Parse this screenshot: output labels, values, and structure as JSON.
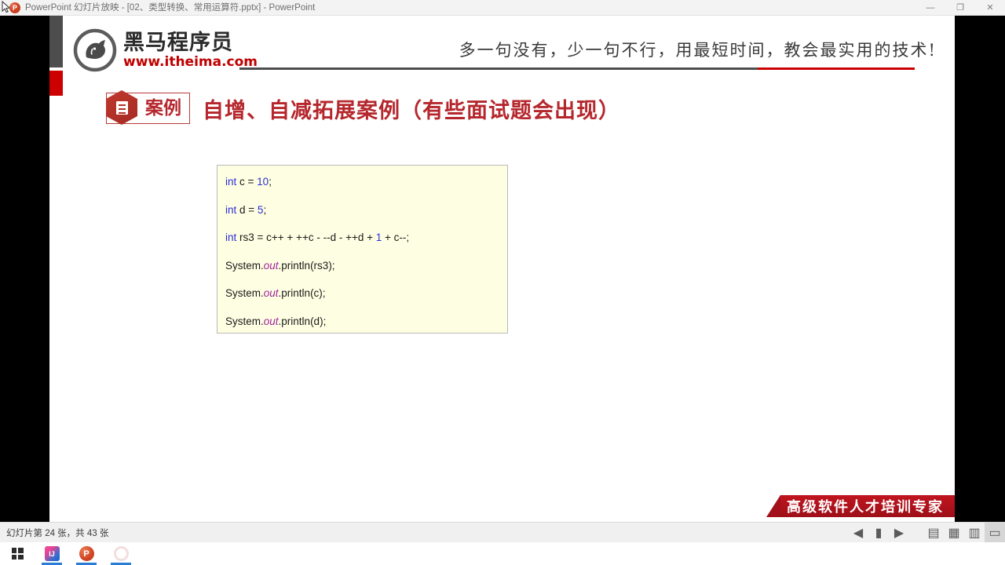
{
  "window": {
    "title": "PowerPoint 幻灯片放映 - [02、类型转换、常用运算符.pptx] - PowerPoint",
    "app_icon": "powerpoint-icon",
    "minimize_label": "—",
    "maximize_label": "❐",
    "close_label": "✕"
  },
  "slide": {
    "logo": {
      "brand_cn": "黑马程序员",
      "url": "www.itheima.com",
      "mark": "horse-logo-icon"
    },
    "tagline": "多一句没有，少一句不行，用最短时间，教会最实用的技术!",
    "badge": {
      "icon": "document-hex-icon",
      "label": "案例"
    },
    "title": "自增、自减拓展案例（有些面试题会出现）",
    "code": {
      "lines": [
        {
          "segments": [
            {
              "t": "int ",
              "c": "kw"
            },
            {
              "t": "c = ",
              "c": ""
            },
            {
              "t": "10",
              "c": "num"
            },
            {
              "t": ";",
              "c": ""
            }
          ]
        },
        {
          "segments": [
            {
              "t": "int ",
              "c": "kw"
            },
            {
              "t": "d = ",
              "c": ""
            },
            {
              "t": "5",
              "c": "num"
            },
            {
              "t": ";",
              "c": ""
            }
          ]
        },
        {
          "segments": [
            {
              "t": "int ",
              "c": "kw"
            },
            {
              "t": "rs3 = c++ + ++c - --d - ++d + ",
              "c": ""
            },
            {
              "t": "1",
              "c": "num"
            },
            {
              "t": " + c--;",
              "c": ""
            }
          ]
        },
        {
          "segments": [
            {
              "t": "System.",
              "c": ""
            },
            {
              "t": "out",
              "c": "fld"
            },
            {
              "t": ".println(rs3);",
              "c": ""
            }
          ]
        },
        {
          "segments": [
            {
              "t": "System.",
              "c": ""
            },
            {
              "t": "out",
              "c": "fld"
            },
            {
              "t": ".println(c);",
              "c": ""
            }
          ]
        },
        {
          "segments": [
            {
              "t": "System.",
              "c": ""
            },
            {
              "t": "out",
              "c": "fld"
            },
            {
              "t": ".println(d);",
              "c": ""
            }
          ]
        }
      ]
    },
    "ribbon_text": "高级软件人才培训专家"
  },
  "statusbar": {
    "slide_counter": "幻灯片第 24 张，共 43 张",
    "controls": [
      {
        "name": "previous-slide-button",
        "glyph": "◀"
      },
      {
        "name": "pen-tools-button",
        "glyph": "▮"
      },
      {
        "name": "next-slide-button",
        "glyph": "▶"
      }
    ],
    "views": [
      {
        "name": "normal-view-button",
        "glyph": "▤"
      },
      {
        "name": "slide-sorter-button",
        "glyph": "▦"
      },
      {
        "name": "reading-view-button",
        "glyph": "▥"
      },
      {
        "name": "slideshow-view-button",
        "glyph": "▭",
        "active": true
      }
    ]
  },
  "taskbar": {
    "items": [
      {
        "name": "start-button",
        "icon": "windows-logo-icon",
        "label": "",
        "running": false
      },
      {
        "name": "taskbar-intellij",
        "icon": "intellij-idea-icon",
        "label": "IJ",
        "running": true
      },
      {
        "name": "taskbar-powerpoint",
        "icon": "powerpoint-icon",
        "label": "P",
        "running": true
      },
      {
        "name": "taskbar-app-4",
        "icon": "circle-app-icon",
        "label": "",
        "running": true
      }
    ]
  },
  "colors": {
    "brand_red": "#c00000",
    "title_red": "#b5272d",
    "code_bg": "#feffe2",
    "keyword_blue": "#2c2cd8",
    "field_purple": "#a020a0"
  }
}
